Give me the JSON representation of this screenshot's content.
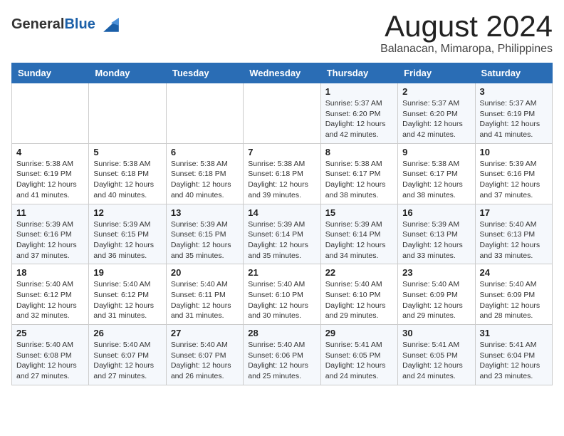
{
  "header": {
    "logo_line1": "General",
    "logo_line2": "Blue",
    "month": "August 2024",
    "location": "Balanacan, Mimaropa, Philippines"
  },
  "columns": [
    "Sunday",
    "Monday",
    "Tuesday",
    "Wednesday",
    "Thursday",
    "Friday",
    "Saturday"
  ],
  "weeks": [
    [
      {
        "num": "",
        "info": ""
      },
      {
        "num": "",
        "info": ""
      },
      {
        "num": "",
        "info": ""
      },
      {
        "num": "",
        "info": ""
      },
      {
        "num": "1",
        "info": "Sunrise: 5:37 AM\nSunset: 6:20 PM\nDaylight: 12 hours and 42 minutes."
      },
      {
        "num": "2",
        "info": "Sunrise: 5:37 AM\nSunset: 6:20 PM\nDaylight: 12 hours and 42 minutes."
      },
      {
        "num": "3",
        "info": "Sunrise: 5:37 AM\nSunset: 6:19 PM\nDaylight: 12 hours and 41 minutes."
      }
    ],
    [
      {
        "num": "4",
        "info": "Sunrise: 5:38 AM\nSunset: 6:19 PM\nDaylight: 12 hours and 41 minutes."
      },
      {
        "num": "5",
        "info": "Sunrise: 5:38 AM\nSunset: 6:18 PM\nDaylight: 12 hours and 40 minutes."
      },
      {
        "num": "6",
        "info": "Sunrise: 5:38 AM\nSunset: 6:18 PM\nDaylight: 12 hours and 40 minutes."
      },
      {
        "num": "7",
        "info": "Sunrise: 5:38 AM\nSunset: 6:18 PM\nDaylight: 12 hours and 39 minutes."
      },
      {
        "num": "8",
        "info": "Sunrise: 5:38 AM\nSunset: 6:17 PM\nDaylight: 12 hours and 38 minutes."
      },
      {
        "num": "9",
        "info": "Sunrise: 5:38 AM\nSunset: 6:17 PM\nDaylight: 12 hours and 38 minutes."
      },
      {
        "num": "10",
        "info": "Sunrise: 5:39 AM\nSunset: 6:16 PM\nDaylight: 12 hours and 37 minutes."
      }
    ],
    [
      {
        "num": "11",
        "info": "Sunrise: 5:39 AM\nSunset: 6:16 PM\nDaylight: 12 hours and 37 minutes."
      },
      {
        "num": "12",
        "info": "Sunrise: 5:39 AM\nSunset: 6:15 PM\nDaylight: 12 hours and 36 minutes."
      },
      {
        "num": "13",
        "info": "Sunrise: 5:39 AM\nSunset: 6:15 PM\nDaylight: 12 hours and 35 minutes."
      },
      {
        "num": "14",
        "info": "Sunrise: 5:39 AM\nSunset: 6:14 PM\nDaylight: 12 hours and 35 minutes."
      },
      {
        "num": "15",
        "info": "Sunrise: 5:39 AM\nSunset: 6:14 PM\nDaylight: 12 hours and 34 minutes."
      },
      {
        "num": "16",
        "info": "Sunrise: 5:39 AM\nSunset: 6:13 PM\nDaylight: 12 hours and 33 minutes."
      },
      {
        "num": "17",
        "info": "Sunrise: 5:40 AM\nSunset: 6:13 PM\nDaylight: 12 hours and 33 minutes."
      }
    ],
    [
      {
        "num": "18",
        "info": "Sunrise: 5:40 AM\nSunset: 6:12 PM\nDaylight: 12 hours and 32 minutes."
      },
      {
        "num": "19",
        "info": "Sunrise: 5:40 AM\nSunset: 6:12 PM\nDaylight: 12 hours and 31 minutes."
      },
      {
        "num": "20",
        "info": "Sunrise: 5:40 AM\nSunset: 6:11 PM\nDaylight: 12 hours and 31 minutes."
      },
      {
        "num": "21",
        "info": "Sunrise: 5:40 AM\nSunset: 6:10 PM\nDaylight: 12 hours and 30 minutes."
      },
      {
        "num": "22",
        "info": "Sunrise: 5:40 AM\nSunset: 6:10 PM\nDaylight: 12 hours and 29 minutes."
      },
      {
        "num": "23",
        "info": "Sunrise: 5:40 AM\nSunset: 6:09 PM\nDaylight: 12 hours and 29 minutes."
      },
      {
        "num": "24",
        "info": "Sunrise: 5:40 AM\nSunset: 6:09 PM\nDaylight: 12 hours and 28 minutes."
      }
    ],
    [
      {
        "num": "25",
        "info": "Sunrise: 5:40 AM\nSunset: 6:08 PM\nDaylight: 12 hours and 27 minutes."
      },
      {
        "num": "26",
        "info": "Sunrise: 5:40 AM\nSunset: 6:07 PM\nDaylight: 12 hours and 27 minutes."
      },
      {
        "num": "27",
        "info": "Sunrise: 5:40 AM\nSunset: 6:07 PM\nDaylight: 12 hours and 26 minutes."
      },
      {
        "num": "28",
        "info": "Sunrise: 5:40 AM\nSunset: 6:06 PM\nDaylight: 12 hours and 25 minutes."
      },
      {
        "num": "29",
        "info": "Sunrise: 5:41 AM\nSunset: 6:05 PM\nDaylight: 12 hours and 24 minutes."
      },
      {
        "num": "30",
        "info": "Sunrise: 5:41 AM\nSunset: 6:05 PM\nDaylight: 12 hours and 24 minutes."
      },
      {
        "num": "31",
        "info": "Sunrise: 5:41 AM\nSunset: 6:04 PM\nDaylight: 12 hours and 23 minutes."
      }
    ]
  ]
}
